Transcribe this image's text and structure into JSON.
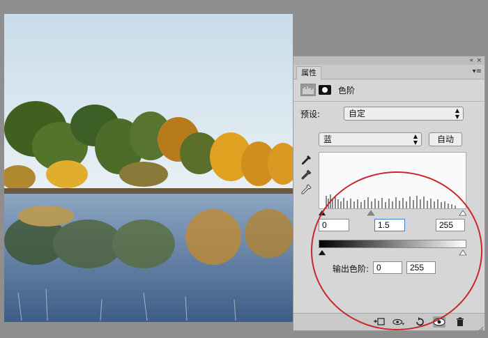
{
  "panel": {
    "tab_label": "属性",
    "collapse_glyph": "«",
    "close_glyph": "×",
    "menu_glyph": "▾≡",
    "adjustment_title": "色阶",
    "preset_label": "预设:",
    "preset_value": "自定",
    "channel_value": "蓝",
    "auto_label": "自动",
    "input_black": "0",
    "input_gamma": "1.5",
    "input_white": "255",
    "output_label": "输出色阶:",
    "output_black": "0",
    "output_white": "255"
  },
  "icons": {
    "histogram": "histogram-icon",
    "mask": "mask-icon",
    "eyedropper_black": "eyedropper-black-icon",
    "eyedropper_gray": "eyedropper-gray-icon",
    "eyedropper_white": "eyedropper-white-icon",
    "clip": "clip-to-layer-icon",
    "view_previous": "view-previous-state-icon",
    "reset": "reset-icon",
    "visibility": "eye-icon",
    "delete": "trash-icon"
  },
  "colors": {
    "panel_bg": "#d6d6d6",
    "annotation": "#c8262c"
  }
}
